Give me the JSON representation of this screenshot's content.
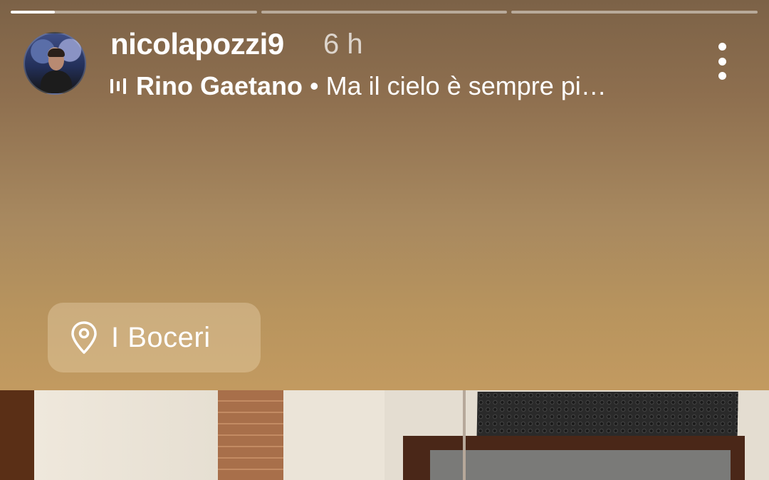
{
  "story": {
    "progress": [
      0.18,
      0,
      0
    ],
    "user": {
      "username": "nicolapozzi9",
      "time": "6 h"
    },
    "music": {
      "artist": "Rino Gaetano",
      "separator": "•",
      "song": "Ma il cielo è sempre pi…"
    },
    "location": {
      "label": "I Boceri"
    }
  },
  "icons": {
    "menu": "more-vertical-icon",
    "music": "music-bars-icon",
    "location": "location-pin-icon"
  }
}
